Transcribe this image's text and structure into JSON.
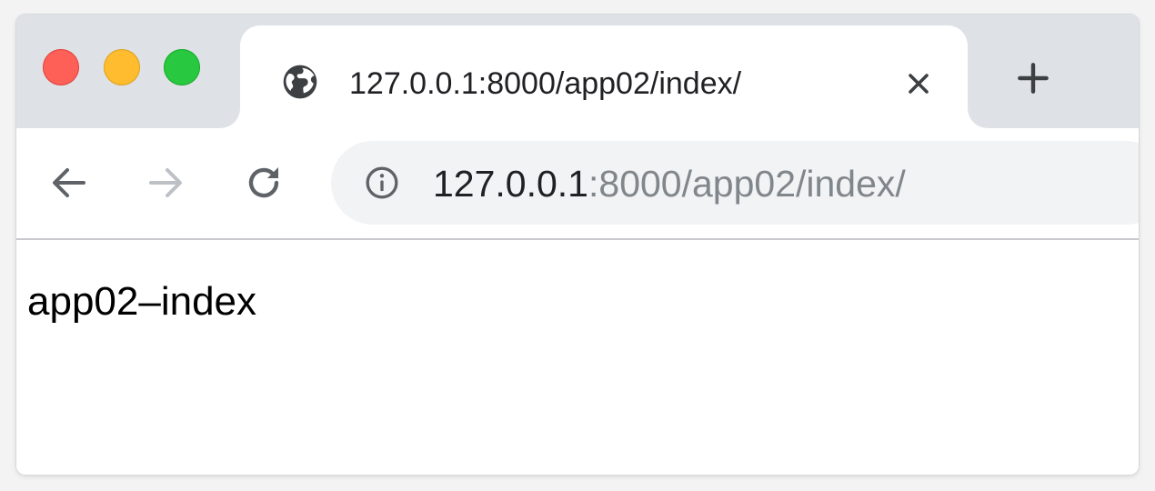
{
  "window": {
    "controls": {
      "close_color": "#fe5f57",
      "minimize_color": "#febc2e",
      "maximize_color": "#28c840"
    }
  },
  "tab": {
    "title": "127.0.0.1:8000/app02/index/",
    "favicon": "globe-icon",
    "close_icon": "close-icon"
  },
  "new_tab_icon": "plus-icon",
  "toolbar": {
    "back_icon": "arrow-left-icon",
    "forward_icon": "arrow-right-icon",
    "forward_enabled": false,
    "reload_icon": "reload-icon"
  },
  "address_bar": {
    "security_icon": "info-icon",
    "url_host": "127.0.0.1",
    "url_rest": ":8000/app02/index/"
  },
  "page": {
    "body_text": "app02–index"
  }
}
